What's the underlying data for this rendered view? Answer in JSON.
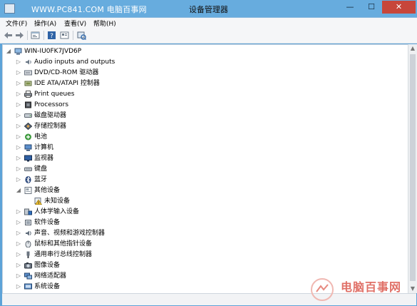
{
  "titlebar": {
    "watermark": "WWW.PC841.COM 电脑百事网",
    "title": "设备管理器",
    "minimize": "—",
    "maximize": "☐",
    "close": "✕"
  },
  "menu": [
    {
      "label": "文件(F)"
    },
    {
      "label": "操作(A)"
    },
    {
      "label": "查看(V)"
    },
    {
      "label": "帮助(H)"
    }
  ],
  "toolbar": {
    "icons": [
      "back-icon",
      "forward-icon",
      "properties-icon",
      "help-icon",
      "view-icon",
      "scan-hardware-icon"
    ]
  },
  "tree": {
    "root": "WIN-IU0FK7JVD6P",
    "items": [
      {
        "label": "Audio inputs and outputs",
        "icon": "speaker-icon",
        "expanded": false,
        "level": 1
      },
      {
        "label": "DVD/CD-ROM 驱动器",
        "icon": "dvd-drive-icon",
        "expanded": false,
        "level": 1
      },
      {
        "label": "IDE ATA/ATAPI 控制器",
        "icon": "ide-controller-icon",
        "expanded": false,
        "level": 1
      },
      {
        "label": "Print queues",
        "icon": "printer-icon",
        "expanded": false,
        "level": 1
      },
      {
        "label": "Processors",
        "icon": "processor-icon",
        "expanded": false,
        "level": 1
      },
      {
        "label": "磁盘驱动器",
        "icon": "disk-drive-icon",
        "expanded": false,
        "level": 1
      },
      {
        "label": "存储控制器",
        "icon": "storage-controller-icon",
        "expanded": false,
        "level": 1
      },
      {
        "label": "电池",
        "icon": "battery-icon",
        "expanded": false,
        "level": 1
      },
      {
        "label": "计算机",
        "icon": "computer-icon",
        "expanded": false,
        "level": 1
      },
      {
        "label": "监视器",
        "icon": "monitor-icon",
        "expanded": false,
        "level": 1
      },
      {
        "label": "键盘",
        "icon": "keyboard-icon",
        "expanded": false,
        "level": 1
      },
      {
        "label": "蓝牙",
        "icon": "bluetooth-icon",
        "expanded": false,
        "level": 1
      },
      {
        "label": "其他设备",
        "icon": "other-devices-icon",
        "expanded": true,
        "level": 1
      },
      {
        "label": "未知设备",
        "icon": "unknown-device-warning-icon",
        "expanded": null,
        "level": 2
      },
      {
        "label": "人体学输入设备",
        "icon": "hid-icon",
        "expanded": false,
        "level": 1
      },
      {
        "label": "软件设备",
        "icon": "software-device-icon",
        "expanded": false,
        "level": 1
      },
      {
        "label": "声音、视频和游戏控制器",
        "icon": "sound-video-icon",
        "expanded": false,
        "level": 1
      },
      {
        "label": "鼠标和其他指针设备",
        "icon": "mouse-icon",
        "expanded": false,
        "level": 1
      },
      {
        "label": "通用串行总线控制器",
        "icon": "usb-icon",
        "expanded": false,
        "level": 1
      },
      {
        "label": "图像设备",
        "icon": "imaging-device-icon",
        "expanded": false,
        "level": 1
      },
      {
        "label": "网络适配器",
        "icon": "network-adapter-icon",
        "expanded": false,
        "level": 1
      },
      {
        "label": "系统设备",
        "icon": "system-device-icon",
        "expanded": false,
        "level": 1
      }
    ]
  },
  "watermark_bottom": "电脑百事网",
  "colors": {
    "titlebar": "#67acde",
    "close": "#c7463a",
    "accent": "#1e6fb8"
  }
}
